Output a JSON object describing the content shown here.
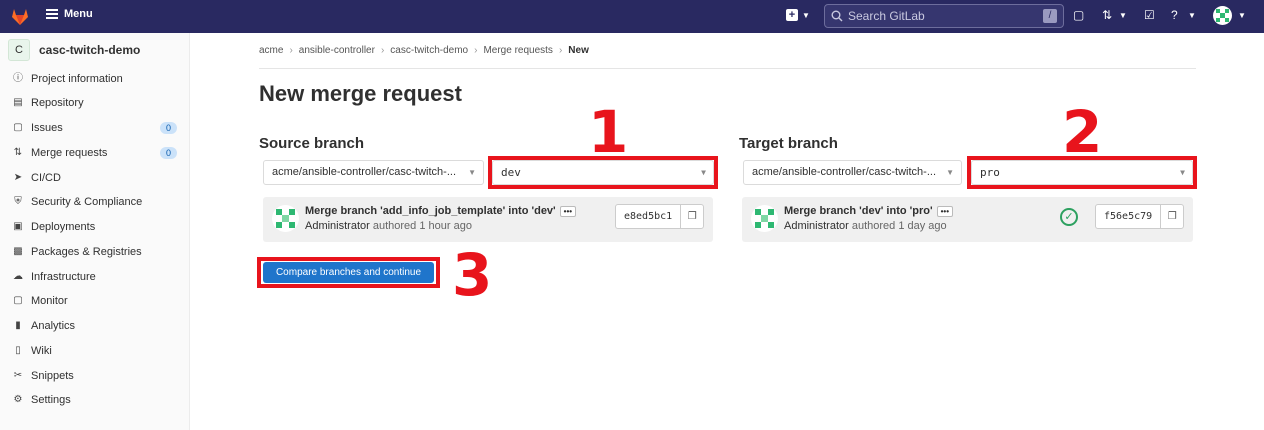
{
  "topbar": {
    "menu_label": "Menu",
    "search_placeholder": "Search GitLab",
    "search_shortcut": "/",
    "colors": {
      "bg": "#292961",
      "logo": "#fc6d26"
    }
  },
  "sidebar": {
    "project_initial": "C",
    "project_name": "casc-twitch-demo",
    "items": [
      {
        "label": "Project information",
        "icon": "info-icon"
      },
      {
        "label": "Repository",
        "icon": "doc-icon"
      },
      {
        "label": "Issues",
        "icon": "issues-icon",
        "badge": "0"
      },
      {
        "label": "Merge requests",
        "icon": "merge-request-icon",
        "badge": "0"
      },
      {
        "label": "CI/CD",
        "icon": "rocket-icon"
      },
      {
        "label": "Security & Compliance",
        "icon": "shield-icon"
      },
      {
        "label": "Deployments",
        "icon": "deploy-icon"
      },
      {
        "label": "Packages & Registries",
        "icon": "package-icon"
      },
      {
        "label": "Infrastructure",
        "icon": "cloud-icon"
      },
      {
        "label": "Monitor",
        "icon": "monitor-icon"
      },
      {
        "label": "Analytics",
        "icon": "chart-icon"
      },
      {
        "label": "Wiki",
        "icon": "book-icon"
      },
      {
        "label": "Snippets",
        "icon": "scissors-icon"
      },
      {
        "label": "Settings",
        "icon": "gear-icon"
      }
    ]
  },
  "breadcrumb": [
    "acme",
    "ansible-controller",
    "casc-twitch-demo",
    "Merge requests",
    "New"
  ],
  "page_title": "New merge request",
  "source": {
    "label": "Source branch",
    "project": "acme/ansible-controller/casc-twitch-...",
    "branch": "dev",
    "commit_title": "Merge branch 'add_info_job_template' into 'dev'",
    "author": "Administrator",
    "authored_text": "authored 1 hour ago",
    "sha": "e8ed5bc1"
  },
  "target": {
    "label": "Target branch",
    "project": "acme/ansible-controller/casc-twitch-...",
    "branch": "pro",
    "commit_title": "Merge branch 'dev' into 'pro'",
    "author": "Administrator",
    "authored_text": "authored 1 day ago",
    "sha": "f56e5c79"
  },
  "compare_button": "Compare branches and continue",
  "annotations": [
    "1",
    "2",
    "3"
  ],
  "accent_colors": {
    "annotation": "#e8141c",
    "button": "#1f75cb",
    "success": "#2da160"
  }
}
